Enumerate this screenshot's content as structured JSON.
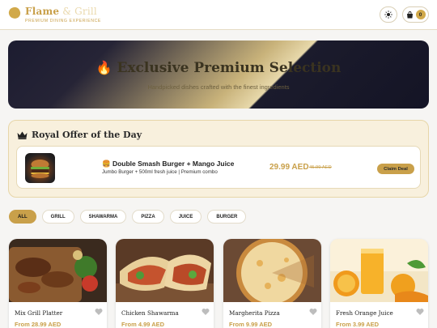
{
  "header": {
    "brand_title_main": "Flame",
    "brand_title_rest": " & Grill",
    "brand_subtitle": "PREMIUM DINING EXPERIENCE",
    "cart_count": "0"
  },
  "hero": {
    "title": "Exclusive Premium Selection",
    "icon": "fire-icon",
    "subtitle": "Handpicked dishes crafted with the finest ingredients"
  },
  "royal_offer": {
    "title": "Royal Offer of the Day",
    "icon": "crown-icon",
    "item_name": "Double Smash Burger + Mango Juice",
    "item_description": "Jumbo Burger + 500ml fresh juice | Premium combo",
    "price": "29.99 AED",
    "old_price": "45.99 AED",
    "claim_label": "Claim Deal"
  },
  "filters": [
    {
      "label": "ALL",
      "active": true
    },
    {
      "label": "GRILL",
      "active": false
    },
    {
      "label": "SHAWARMA",
      "active": false
    },
    {
      "label": "PIZZA",
      "active": false
    },
    {
      "label": "JUICE",
      "active": false
    },
    {
      "label": "BURGER",
      "active": false
    }
  ],
  "products": [
    {
      "name": "Mix Grill Platter",
      "price": "From 28.99 AED"
    },
    {
      "name": "Chicken Shawarma",
      "price": "From 4.99 AED"
    },
    {
      "name": "Margherita Pizza",
      "price": "From 9.99 AED"
    },
    {
      "name": "Fresh Orange Juice",
      "price": "From 3.99 AED"
    }
  ],
  "colors": {
    "accent_gold": "#c9a04a",
    "hero_dark": "#1c1c30",
    "offer_bg": "#f8f0dd"
  }
}
